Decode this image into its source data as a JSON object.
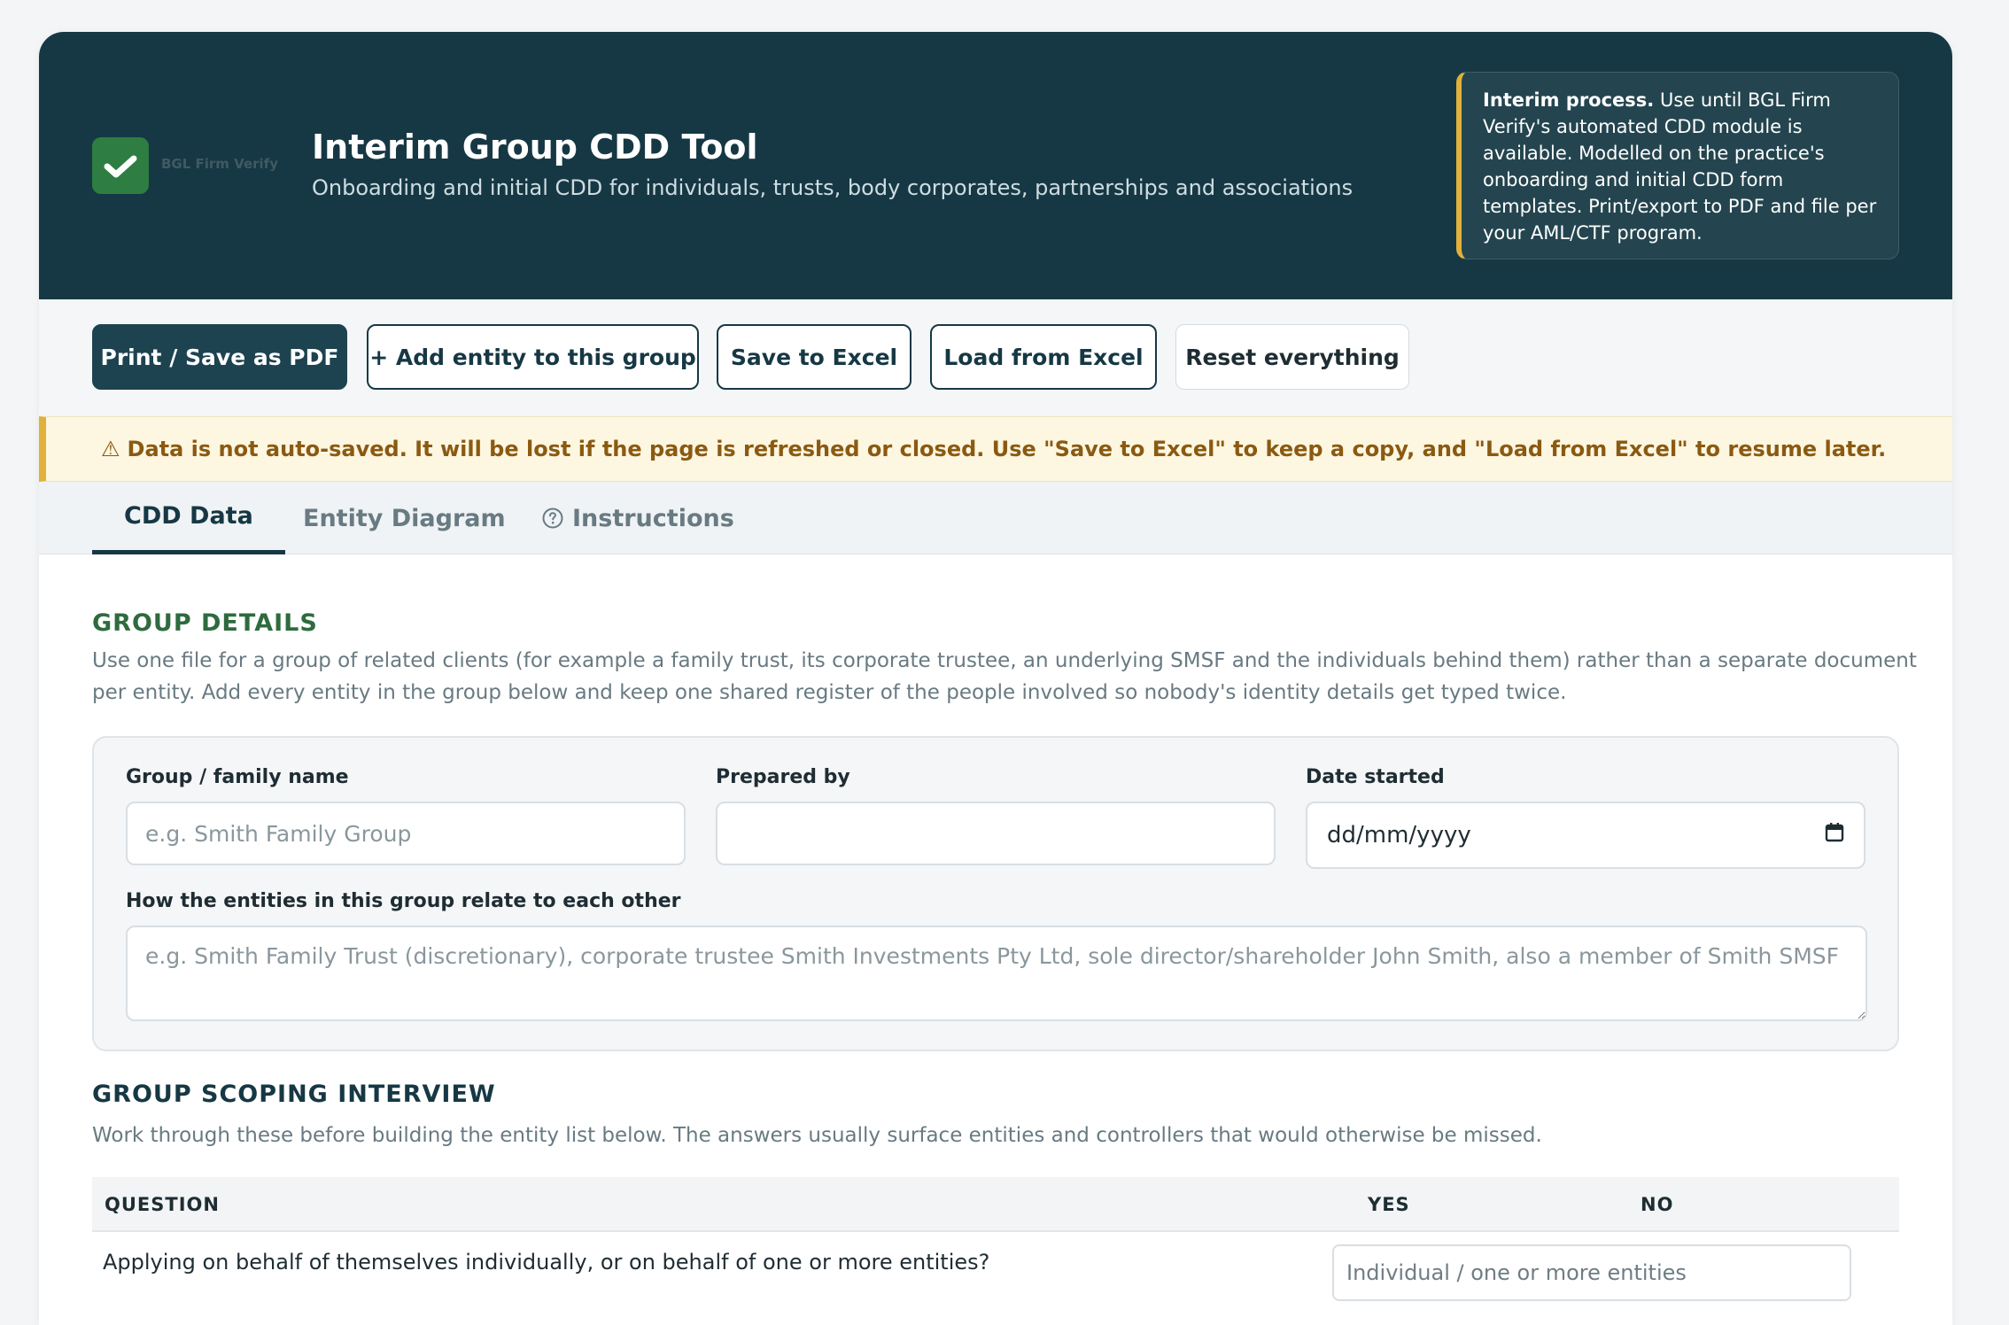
{
  "header": {
    "logo_text": "BGL Firm Verify",
    "title": "Interim Group CDD Tool",
    "subtitle": "Onboarding and initial CDD for individuals, trusts, body corporates, partnerships and associations",
    "notice_bold": "Interim process.",
    "notice_text": " Use until BGL Firm Verify's automated CDD module is available. Modelled on the practice's onboarding and initial CDD form templates. Print/export to PDF and file per your AML/CTF program."
  },
  "toolbar": {
    "print_label": "Print / Save as PDF",
    "add_entity_label": "+ Add entity to this group",
    "save_excel_label": "Save to Excel",
    "load_excel_label": "Load from Excel",
    "reset_label": "Reset everything"
  },
  "warning": {
    "icon": "⚠",
    "text": "Data is not auto-saved. It will be lost if the page is refreshed or closed. Use \"Save to Excel\" to keep a copy, and \"Load from Excel\" to resume later."
  },
  "tabs": {
    "cdd_data": "CDD Data",
    "entity_diagram": "Entity Diagram",
    "instructions": "Instructions",
    "active": "CDD Data"
  },
  "group_details": {
    "title": "GROUP DETAILS",
    "description": "Use one file for a group of related clients (for example a family trust, its corporate trustee, an underlying SMSF and the individuals behind them) rather than a separate document per entity. Add every entity in the group below and keep one shared register of the people involved so nobody's identity details get typed twice.",
    "group_name_label": "Group / family name",
    "group_name_placeholder": "e.g. Smith Family Group",
    "group_name_value": "",
    "prepared_by_label": "Prepared by",
    "prepared_by_value": "",
    "date_started_label": "Date started",
    "date_started_placeholder": "dd/mm/yyyy",
    "relation_label": "How the entities in this group relate to each other",
    "relation_placeholder": "e.g. Smith Family Trust (discretionary), corporate trustee Smith Investments Pty Ltd, sole director/shareholder John Smith, also a member of Smith SMSF",
    "relation_value": ""
  },
  "scoping": {
    "title": "GROUP SCOPING INTERVIEW",
    "description": "Work through these before building the entity list below. The answers usually surface entities and controllers that would otherwise be missed.",
    "columns": [
      "QUESTION",
      "YES",
      "NO"
    ],
    "rows": [
      {
        "question": "Applying on behalf of themselves individually, or on behalf of one or more entities?",
        "answer_placeholder": "Individual / one or more entities"
      }
    ]
  },
  "colors": {
    "header_bg": "#163844",
    "accent_green": "#2e7d42",
    "warning_bg": "#fdf6e0",
    "warning_border": "#e0b13b"
  }
}
